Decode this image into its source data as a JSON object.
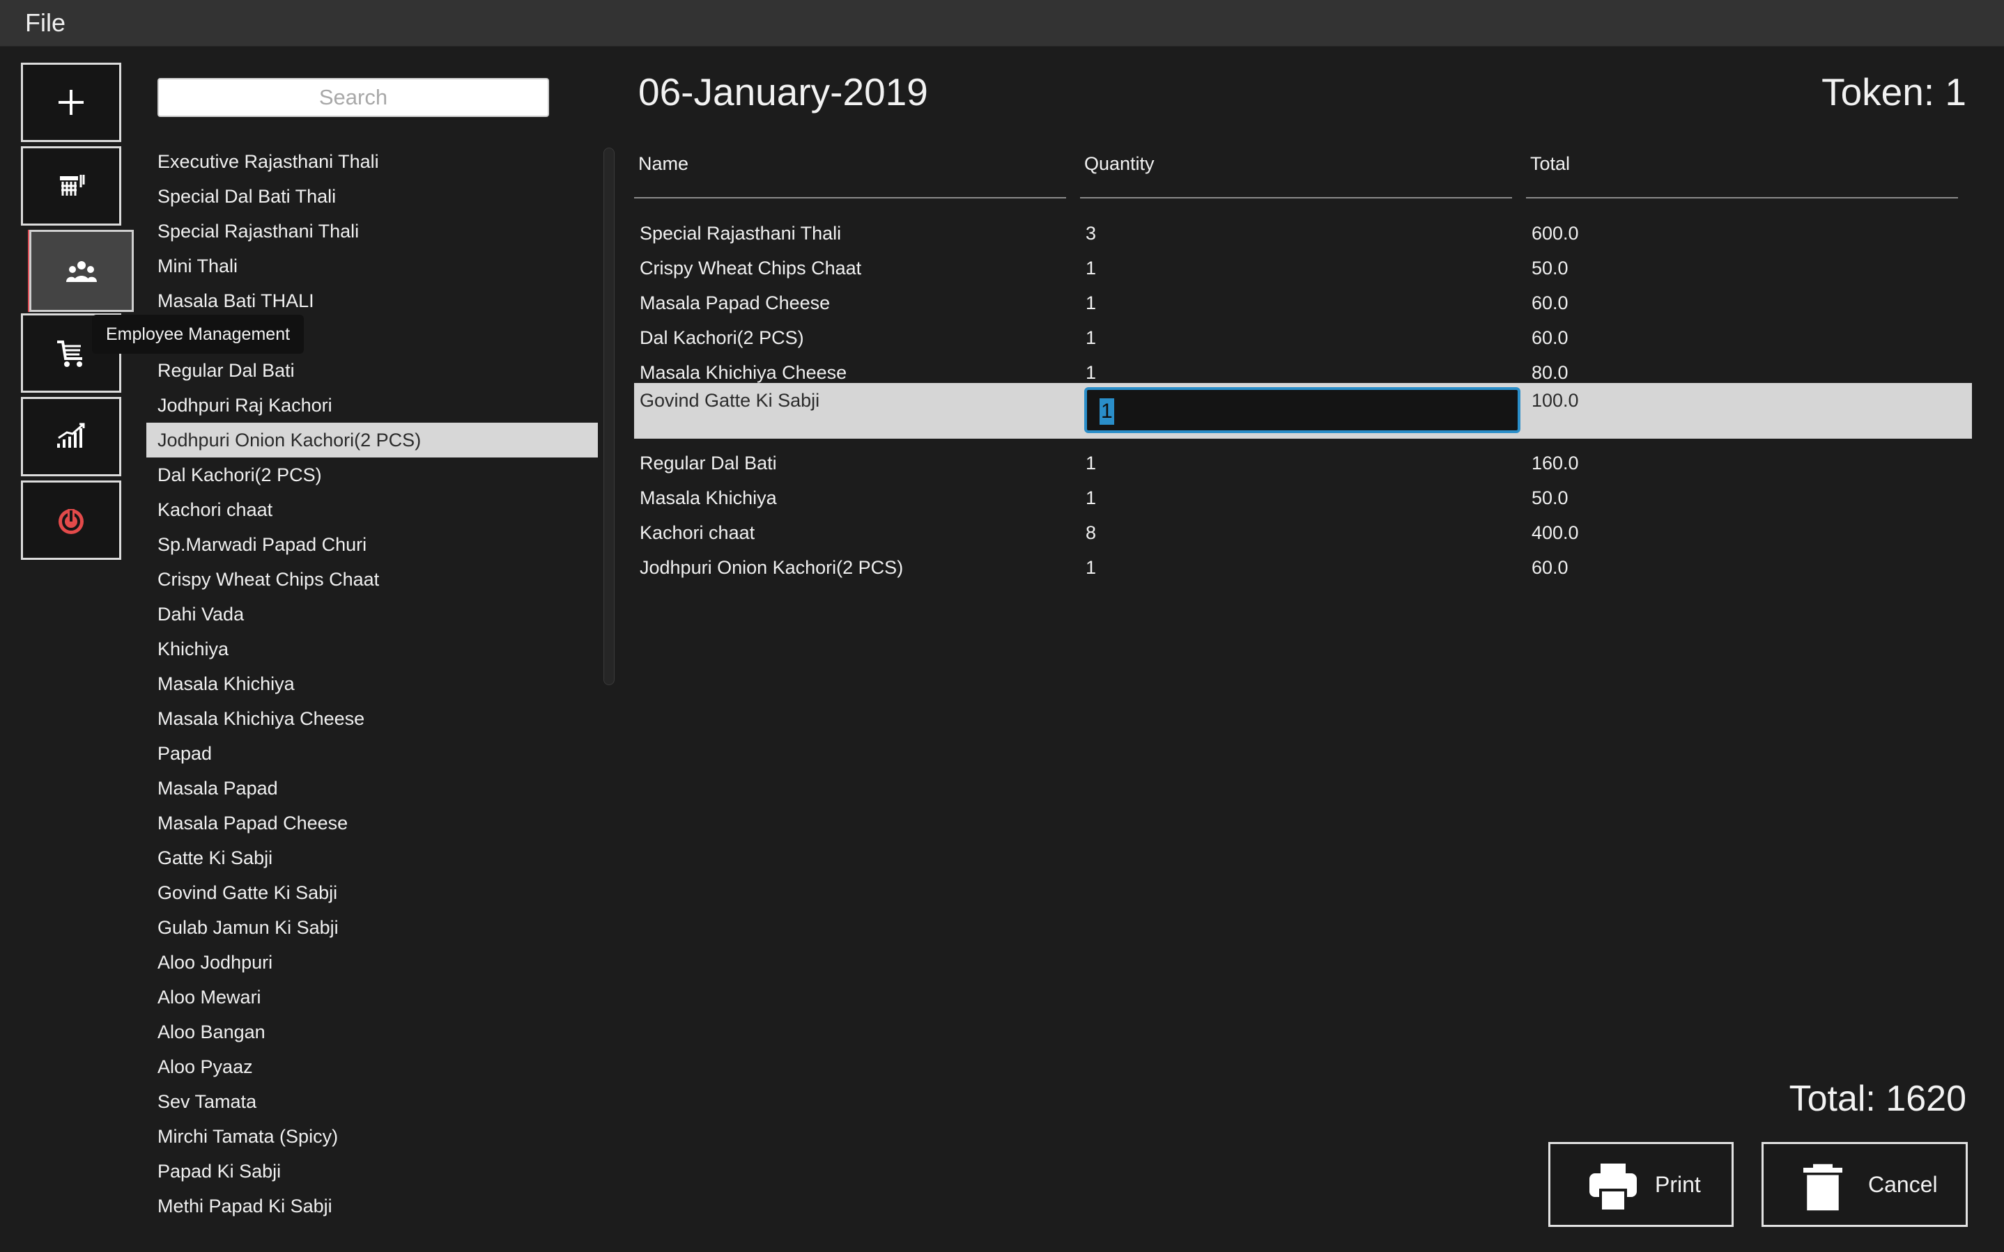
{
  "menubar": {
    "file": "File"
  },
  "rail": {
    "add_icon": "plus-icon",
    "menu_icon": "food-menu-icon",
    "employee_icon": "employees-icon",
    "orders_icon": "cart-icon",
    "reports_icon": "chart-icon",
    "power_icon": "power-icon",
    "power_color": "#e34a4a",
    "active_accent": "#e0525a"
  },
  "tooltip": "Employee Management",
  "search": {
    "placeholder": "Search",
    "value": ""
  },
  "menu_items": [
    "Executive Rajasthani Thali",
    "Special Dal Bati Thali",
    "Special Rajasthani Thali",
    "Mini Thali",
    "Masala Bati THALI",
    "",
    "Regular Dal Bati",
    "Jodhpuri Raj Kachori",
    "Jodhpuri Onion Kachori(2 PCS)",
    "Dal Kachori(2 PCS)",
    "Kachori chaat",
    "Sp.Marwadi Papad Churi",
    "Crispy Wheat Chips Chaat",
    "Dahi Vada",
    "Khichiya",
    "Masala Khichiya",
    "Masala Khichiya Cheese",
    "Papad",
    "Masala Papad",
    "Masala Papad Cheese",
    "Gatte Ki Sabji",
    "Govind Gatte Ki Sabji",
    "Gulab Jamun Ki Sabji",
    "Aloo Jodhpuri",
    "Aloo Mewari",
    "Aloo Bangan",
    "Aloo Pyaaz",
    "Sev Tamata",
    "Mirchi Tamata (Spicy)",
    "Papad Ki Sabji",
    "Methi Papad Ki Sabji"
  ],
  "selected_menu_item": "Jodhpuri Onion Kachori(2 PCS)",
  "header": {
    "date": "06-January-2019",
    "token": "Token: 1"
  },
  "order": {
    "columns": [
      "Name",
      "Quantity",
      "Total"
    ],
    "rows": [
      {
        "name": "Special Rajasthani Thali",
        "qty": "3",
        "total": "600.0"
      },
      {
        "name": "Crispy Wheat Chips Chaat",
        "qty": "1",
        "total": "50.0"
      },
      {
        "name": "Masala Papad Cheese",
        "qty": "1",
        "total": "60.0"
      },
      {
        "name": "Dal Kachori(2 PCS)",
        "qty": "1",
        "total": "60.0"
      },
      {
        "name": "Masala Khichiya Cheese",
        "qty": "1",
        "total": "80.0"
      },
      {
        "name": "Govind Gatte Ki Sabji",
        "qty": "1",
        "total": "100.0",
        "editing": true
      },
      {
        "name": "Regular Dal Bati",
        "qty": "1",
        "total": "160.0"
      },
      {
        "name": "Masala Khichiya",
        "qty": "1",
        "total": "50.0"
      },
      {
        "name": "Kachori chaat",
        "qty": "8",
        "total": "400.0"
      },
      {
        "name": "Jodhpuri Onion Kachori(2 PCS)",
        "qty": "1",
        "total": "60.0"
      }
    ]
  },
  "footer": {
    "total": "Total: 1620",
    "print_label": "Print",
    "print_icon": "printer-icon",
    "cancel_label": "Cancel",
    "cancel_icon": "trash-icon"
  }
}
